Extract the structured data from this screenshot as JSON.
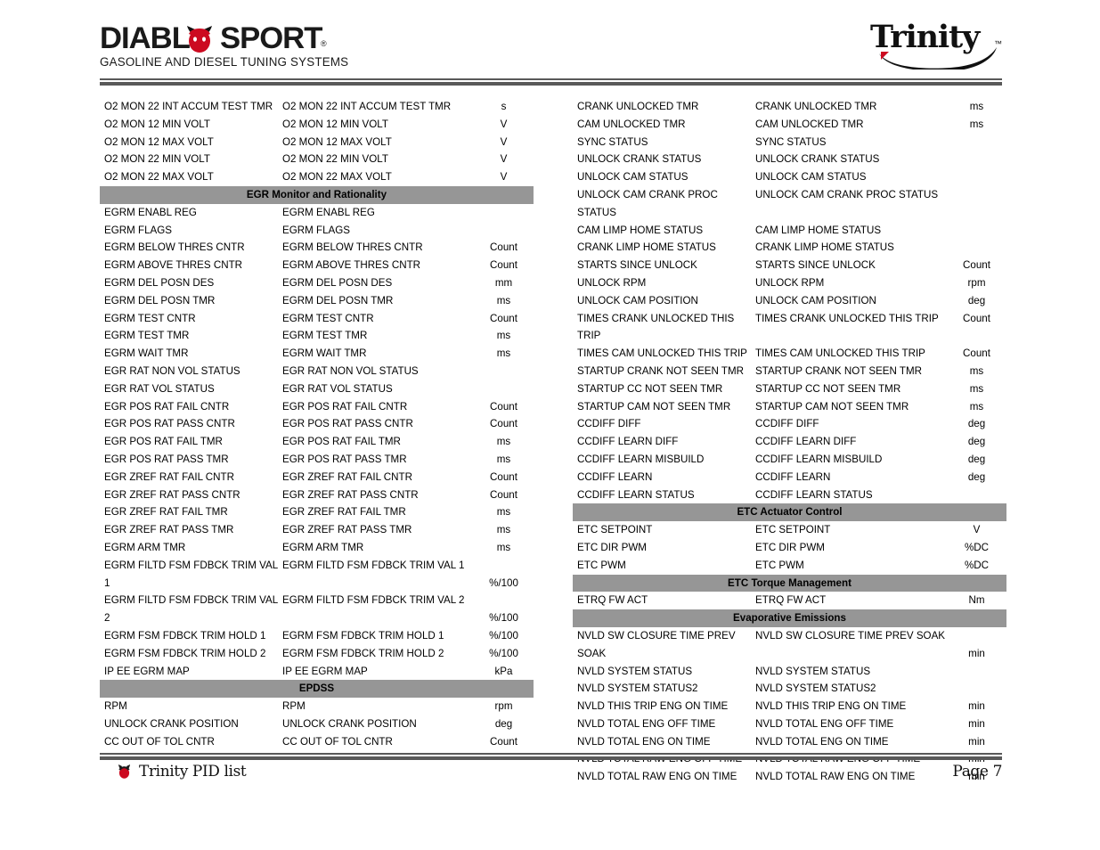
{
  "header": {
    "brand_logo": {
      "name": "DiabloSport",
      "text_part_a": "DIABL",
      "text_part_b": "SPORT",
      "registered_mark": "®",
      "tagline": "GASOLINE AND DIESEL TUNING SYSTEMS"
    },
    "product_logo": {
      "name": "Trinity",
      "wordmark": "Trinity",
      "trademark": "™"
    }
  },
  "colors": {
    "section_bar": "#969696",
    "rule": "#595959",
    "devil_red": "#cc0a20",
    "text": "#000000"
  },
  "footer": {
    "title": "Trinity PID list",
    "page_label": "Page 7"
  },
  "left_column": [
    {
      "type": "row",
      "name": "O2 MON 22 INT ACCUM TEST TMR",
      "desc": "O2 MON 22 INT ACCUM TEST TMR",
      "unit": "s"
    },
    {
      "type": "row",
      "name": "O2 MON 12 MIN VOLT",
      "desc": "O2 MON 12 MIN VOLT",
      "unit": "V"
    },
    {
      "type": "row",
      "name": "O2 MON 12 MAX VOLT",
      "desc": "O2 MON 12 MAX VOLT",
      "unit": "V"
    },
    {
      "type": "row",
      "name": "O2 MON 22 MIN VOLT",
      "desc": "O2 MON 22 MIN VOLT",
      "unit": "V"
    },
    {
      "type": "row",
      "name": "O2 MON 22 MAX VOLT",
      "desc": "O2 MON 22 MAX VOLT",
      "unit": "V"
    },
    {
      "type": "section",
      "title": "EGR Monitor and Rationality"
    },
    {
      "type": "row",
      "name": "EGRM ENABL REG",
      "desc": "EGRM ENABL REG",
      "unit": ""
    },
    {
      "type": "row",
      "name": "EGRM FLAGS",
      "desc": "EGRM FLAGS",
      "unit": ""
    },
    {
      "type": "row",
      "name": "EGRM BELOW THRES CNTR",
      "desc": "EGRM BELOW THRES CNTR",
      "unit": "Count"
    },
    {
      "type": "row",
      "name": "EGRM ABOVE THRES CNTR",
      "desc": "EGRM ABOVE THRES CNTR",
      "unit": "Count"
    },
    {
      "type": "row",
      "name": "EGRM DEL POSN DES",
      "desc": "EGRM DEL POSN DES",
      "unit": "mm"
    },
    {
      "type": "row",
      "name": "EGRM DEL POSN TMR",
      "desc": "EGRM DEL POSN TMR",
      "unit": "ms"
    },
    {
      "type": "row",
      "name": "EGRM TEST CNTR",
      "desc": "EGRM TEST CNTR",
      "unit": "Count"
    },
    {
      "type": "row",
      "name": "EGRM TEST TMR",
      "desc": "EGRM TEST TMR",
      "unit": "ms"
    },
    {
      "type": "row",
      "name": "EGRM WAIT TMR",
      "desc": "EGRM WAIT TMR",
      "unit": "ms"
    },
    {
      "type": "row",
      "name": "EGR RAT NON VOL STATUS",
      "desc": "EGR RAT NON VOL STATUS",
      "unit": ""
    },
    {
      "type": "row",
      "name": "EGR RAT VOL STATUS",
      "desc": "EGR RAT VOL STATUS",
      "unit": ""
    },
    {
      "type": "row",
      "name": "EGR POS RAT FAIL CNTR",
      "desc": "EGR POS RAT FAIL CNTR",
      "unit": "Count"
    },
    {
      "type": "row",
      "name": "EGR POS RAT PASS CNTR",
      "desc": "EGR POS RAT PASS CNTR",
      "unit": "Count"
    },
    {
      "type": "row",
      "name": "EGR POS RAT FAIL TMR",
      "desc": "EGR POS RAT FAIL TMR",
      "unit": "ms"
    },
    {
      "type": "row",
      "name": "EGR POS RAT PASS TMR",
      "desc": "EGR POS RAT PASS TMR",
      "unit": "ms"
    },
    {
      "type": "row",
      "name": "EGR ZREF RAT FAIL CNTR",
      "desc": "EGR ZREF RAT FAIL CNTR",
      "unit": "Count"
    },
    {
      "type": "row",
      "name": "EGR ZREF RAT PASS CNTR",
      "desc": "EGR ZREF RAT PASS CNTR",
      "unit": "Count"
    },
    {
      "type": "row",
      "name": "EGR ZREF RAT FAIL TMR",
      "desc": "EGR ZREF RAT FAIL TMR",
      "unit": "ms"
    },
    {
      "type": "row",
      "name": "EGR ZREF RAT PASS TMR",
      "desc": "EGR ZREF RAT PASS TMR",
      "unit": "ms"
    },
    {
      "type": "row",
      "name": "EGRM ARM TMR",
      "desc": "EGRM ARM TMR",
      "unit": "ms"
    },
    {
      "type": "row",
      "wrap": true,
      "name": "EGRM FILTD FSM FDBCK TRIM VAL 1",
      "desc": "EGRM FILTD FSM FDBCK TRIM VAL 1",
      "unit": "%/100"
    },
    {
      "type": "row",
      "wrap": true,
      "name": "EGRM FILTD FSM FDBCK TRIM VAL 2",
      "desc": "EGRM FILTD FSM FDBCK TRIM VAL 2",
      "unit": "%/100"
    },
    {
      "type": "row",
      "name": "EGRM FSM FDBCK TRIM HOLD 1",
      "desc": "EGRM FSM FDBCK TRIM HOLD 1",
      "unit": "%/100"
    },
    {
      "type": "row",
      "name": "EGRM FSM FDBCK TRIM HOLD 2",
      "desc": "EGRM FSM FDBCK TRIM HOLD 2",
      "unit": "%/100"
    },
    {
      "type": "row",
      "name": "IP EE EGRM MAP",
      "desc": "IP EE EGRM MAP",
      "unit": "kPa"
    },
    {
      "type": "section",
      "title": "EPDSS"
    },
    {
      "type": "row",
      "name": "RPM",
      "desc": "RPM",
      "unit": "rpm"
    },
    {
      "type": "row",
      "name": "UNLOCK CRANK POSITION",
      "desc": "UNLOCK CRANK POSITION",
      "unit": "deg"
    },
    {
      "type": "row",
      "name": "CC OUT OF TOL CNTR",
      "desc": "CC OUT OF TOL CNTR",
      "unit": "Count"
    }
  ],
  "right_column": [
    {
      "type": "row",
      "name": "CRANK UNLOCKED TMR",
      "desc": "CRANK UNLOCKED TMR",
      "unit": "ms"
    },
    {
      "type": "row",
      "name": "CAM UNLOCKED TMR",
      "desc": "CAM UNLOCKED TMR",
      "unit": "ms"
    },
    {
      "type": "row",
      "name": "SYNC STATUS",
      "desc": "SYNC STATUS",
      "unit": ""
    },
    {
      "type": "row",
      "name": "UNLOCK CRANK STATUS",
      "desc": "UNLOCK CRANK STATUS",
      "unit": ""
    },
    {
      "type": "row",
      "name": "UNLOCK CAM STATUS",
      "desc": "UNLOCK CAM STATUS",
      "unit": ""
    },
    {
      "type": "row",
      "name": "UNLOCK CAM CRANK PROC STATUS",
      "desc": "UNLOCK CAM CRANK PROC STATUS",
      "unit": ""
    },
    {
      "type": "row",
      "name": "CAM LIMP HOME STATUS",
      "desc": "CAM LIMP HOME STATUS",
      "unit": ""
    },
    {
      "type": "row",
      "name": "CRANK LIMP HOME STATUS",
      "desc": "CRANK LIMP HOME STATUS",
      "unit": ""
    },
    {
      "type": "row",
      "name": "STARTS SINCE UNLOCK",
      "desc": "STARTS SINCE UNLOCK",
      "unit": "Count"
    },
    {
      "type": "row",
      "name": "UNLOCK RPM",
      "desc": "UNLOCK RPM",
      "unit": "rpm"
    },
    {
      "type": "row",
      "name": "UNLOCK CAM POSITION",
      "desc": "UNLOCK CAM POSITION",
      "unit": "deg"
    },
    {
      "type": "row",
      "name": "TIMES CRANK UNLOCKED THIS TRIP",
      "desc": "TIMES CRANK UNLOCKED THIS TRIP",
      "unit": "Count"
    },
    {
      "type": "row",
      "name": "TIMES CAM UNLOCKED THIS TRIP",
      "desc": "TIMES CAM UNLOCKED THIS TRIP",
      "unit": "Count"
    },
    {
      "type": "row",
      "name": "STARTUP CRANK NOT SEEN TMR",
      "desc": "STARTUP CRANK NOT SEEN TMR",
      "unit": "ms"
    },
    {
      "type": "row",
      "name": "STARTUP CC NOT SEEN TMR",
      "desc": "STARTUP CC NOT SEEN TMR",
      "unit": "ms"
    },
    {
      "type": "row",
      "name": "STARTUP CAM NOT SEEN TMR",
      "desc": "STARTUP CAM NOT SEEN TMR",
      "unit": "ms"
    },
    {
      "type": "row",
      "name": "CCDIFF DIFF",
      "desc": "CCDIFF DIFF",
      "unit": "deg"
    },
    {
      "type": "row",
      "name": "CCDIFF LEARN DIFF",
      "desc": "CCDIFF LEARN DIFF",
      "unit": "deg"
    },
    {
      "type": "row",
      "name": "CCDIFF LEARN MISBUILD",
      "desc": "CCDIFF LEARN MISBUILD",
      "unit": "deg"
    },
    {
      "type": "row",
      "name": "CCDIFF LEARN",
      "desc": "CCDIFF LEARN",
      "unit": "deg"
    },
    {
      "type": "row",
      "name": "CCDIFF LEARN STATUS",
      "desc": "CCDIFF LEARN STATUS",
      "unit": ""
    },
    {
      "type": "section",
      "title": "ETC Actuator Control"
    },
    {
      "type": "row",
      "name": "ETC SETPOINT",
      "desc": "ETC SETPOINT",
      "unit": "V"
    },
    {
      "type": "row",
      "name": "ETC DIR PWM",
      "desc": "ETC DIR PWM",
      "unit": "%DC"
    },
    {
      "type": "row",
      "name": "ETC PWM",
      "desc": "ETC PWM",
      "unit": "%DC"
    },
    {
      "type": "section",
      "title": "ETC Torque Management"
    },
    {
      "type": "row",
      "name": "ETRQ FW ACT",
      "desc": "ETRQ FW ACT",
      "unit": "Nm"
    },
    {
      "type": "section",
      "title": "Evaporative Emissions"
    },
    {
      "type": "row",
      "wrap": true,
      "name": "NVLD SW CLOSURE TIME PREV SOAK",
      "desc": "NVLD SW CLOSURE TIME PREV SOAK",
      "unit": "min"
    },
    {
      "type": "row",
      "name": "NVLD SYSTEM STATUS",
      "desc": "NVLD SYSTEM STATUS",
      "unit": ""
    },
    {
      "type": "row",
      "name": "NVLD SYSTEM STATUS2",
      "desc": "NVLD SYSTEM STATUS2",
      "unit": ""
    },
    {
      "type": "row",
      "name": "NVLD THIS TRIP ENG ON TIME",
      "desc": "NVLD THIS TRIP ENG ON TIME",
      "unit": "min"
    },
    {
      "type": "row",
      "name": "NVLD TOTAL ENG OFF TIME",
      "desc": "NVLD TOTAL ENG OFF TIME",
      "unit": "min"
    },
    {
      "type": "row",
      "name": "NVLD TOTAL ENG ON TIME",
      "desc": "NVLD TOTAL ENG ON TIME",
      "unit": "min"
    },
    {
      "type": "row",
      "name": "NVLD TOTAL RAW ENG OFF TIME",
      "desc": "NVLD TOTAL RAW ENG OFF TIME",
      "unit": "min"
    },
    {
      "type": "row",
      "name": "NVLD TOTAL RAW ENG ON TIME",
      "desc": "NVLD TOTAL RAW ENG ON TIME",
      "unit": "min"
    }
  ]
}
